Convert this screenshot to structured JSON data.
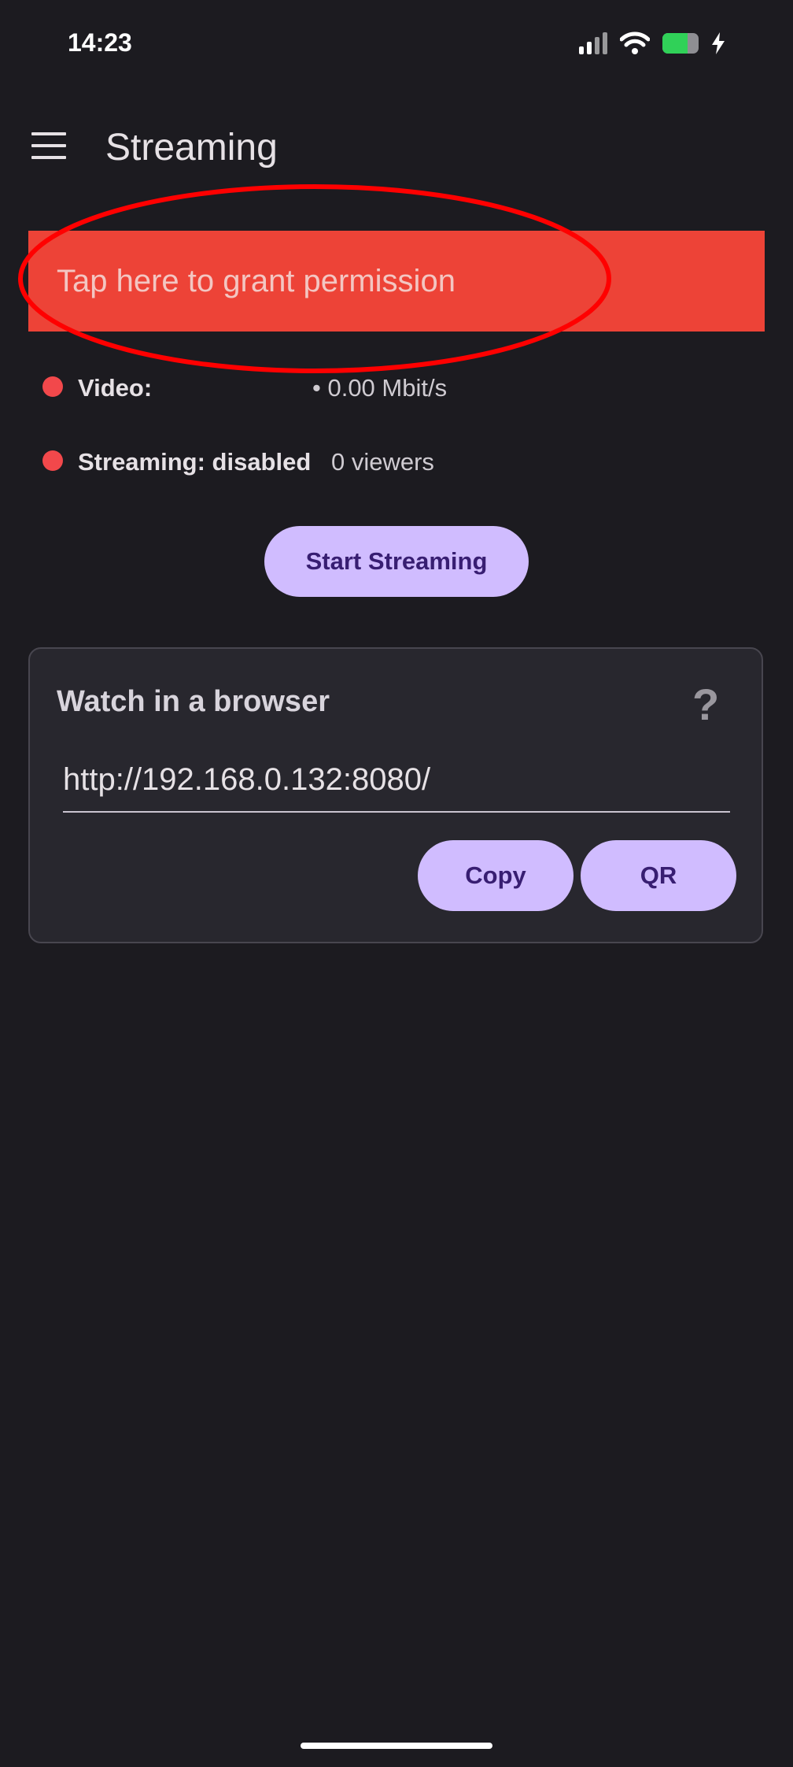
{
  "status_bar": {
    "time": "14:23",
    "icons": [
      "signal-icon",
      "wifi-icon",
      "battery-charging-icon"
    ],
    "battery_level": 0.7
  },
  "app_bar": {
    "menu_icon": "hamburger-menu-icon",
    "title": "Streaming"
  },
  "permission_banner": {
    "label": "Tap here to grant permission",
    "color": "#ed4337"
  },
  "annotation": {
    "shape": "oval",
    "color": "#ff0000"
  },
  "status": {
    "video": {
      "label": "Video:",
      "value": "• 0.00 Mbit/s",
      "indicator_color": "#f2484b"
    },
    "streaming": {
      "label": "Streaming: disabled",
      "value": "0 viewers",
      "indicator_color": "#f2484b"
    }
  },
  "start_button": {
    "label": "Start Streaming"
  },
  "browser_card": {
    "title": "Watch in a browser",
    "help_label": "?",
    "url": "http://192.168.0.132:8080/",
    "copy_label": "Copy",
    "qr_label": "QR"
  },
  "colors": {
    "background": "#1c1b20",
    "accent": "#d0bcff",
    "accent_text": "#381e72"
  }
}
